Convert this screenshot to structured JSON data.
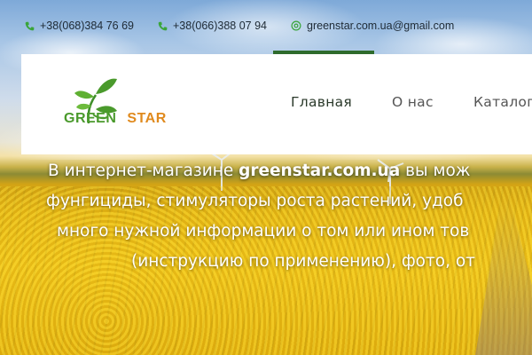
{
  "contacts": {
    "phone1": "+38(068)384 76 69",
    "phone2": "+38(066)388 07 94",
    "email": "greenstar.com.ua@gmail.com"
  },
  "logo": {
    "text_part1": "GREEN",
    "text_part2": "STAR",
    "colors": {
      "green": "#4a9a2c",
      "orange": "#e08a1e"
    }
  },
  "nav": {
    "items": [
      {
        "label": "Главная",
        "active": true
      },
      {
        "label": "О нас",
        "active": false
      },
      {
        "label": "Каталог",
        "active": false
      }
    ],
    "accent": "#2e6b2c"
  },
  "intro": {
    "line1_prefix": "В интернет-магазине ",
    "line1_bold": "greenstar.com.ua",
    "line1_suffix": " вы мож",
    "line2": "фунгициды, стимуляторы роста растений, удоб",
    "line3": "много нужной информации о том или ином тов",
    "line4": "(инструкцию по применению), фото, от"
  },
  "icons": {
    "phone": "phone-icon",
    "email": "email-icon"
  }
}
